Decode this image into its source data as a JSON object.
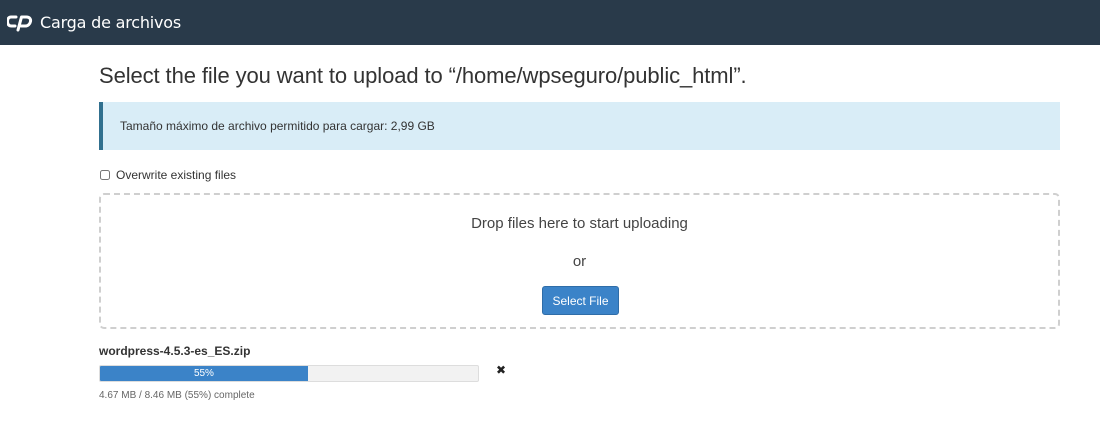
{
  "header": {
    "app_title": "Carga de archivos",
    "logo_icon": "cpanel-logo-icon",
    "background": "#293a4a"
  },
  "main": {
    "heading": "Select the file you want to upload to “/home/wpseguro/public_html”.",
    "info_text": "Tamaño máximo de archivo permitido para cargar: 2,99 GB",
    "overwrite_label": "Overwrite existing files",
    "overwrite_checked": false,
    "dropzone": {
      "drop_text": "Drop files here to start uploading",
      "or_text": "or",
      "select_button": "Select File"
    },
    "upload": {
      "file_name": "wordpress-4.5.3-es_ES.zip",
      "progress_percent": 55,
      "progress_label": "55%",
      "status_text": "4.67 MB / 8.46 MB (55%) complete",
      "cancel_icon": "close-icon"
    }
  },
  "colors": {
    "accent": "#3b83c8",
    "info_background": "#d9edf7",
    "info_border": "#31708f"
  }
}
